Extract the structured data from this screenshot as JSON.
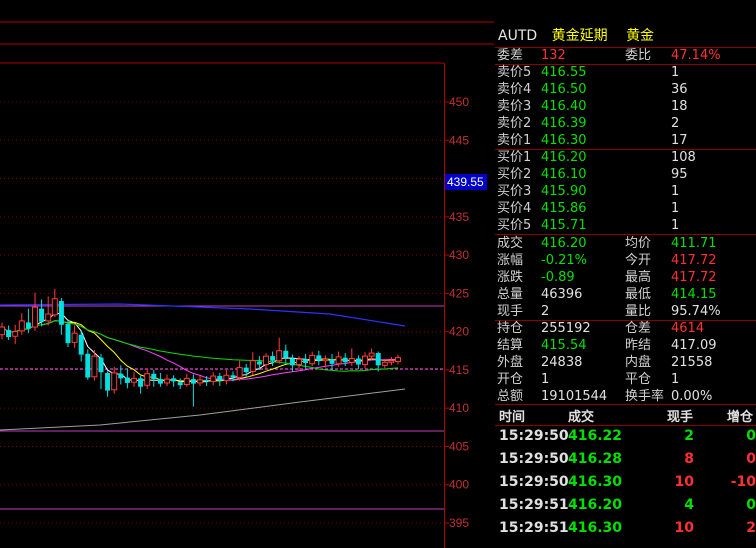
{
  "header": {
    "code": "AUTD",
    "name": "黄金延期",
    "type": "黄金"
  },
  "order_book": {
    "weicha_label": "委差",
    "weicha_value": "132",
    "weibi_label": "委比",
    "weibi_value": "47.14%",
    "asks": [
      {
        "label": "卖价5",
        "price": "416.55",
        "volume": "1"
      },
      {
        "label": "卖价4",
        "price": "416.50",
        "volume": "36"
      },
      {
        "label": "卖价3",
        "price": "416.40",
        "volume": "18"
      },
      {
        "label": "卖价2",
        "price": "416.39",
        "volume": "2"
      },
      {
        "label": "卖价1",
        "price": "416.30",
        "volume": "17"
      }
    ],
    "bids": [
      {
        "label": "买价1",
        "price": "416.20",
        "volume": "108"
      },
      {
        "label": "买价2",
        "price": "416.10",
        "volume": "95"
      },
      {
        "label": "买价3",
        "price": "415.90",
        "volume": "1"
      },
      {
        "label": "买价4",
        "price": "415.86",
        "volume": "1"
      },
      {
        "label": "买价5",
        "price": "415.71",
        "volume": "1"
      }
    ]
  },
  "stats": [
    {
      "l1": "成交",
      "v1": "416.20",
      "c1": "green",
      "l2": "均价",
      "v2": "411.71",
      "c2": "green"
    },
    {
      "l1": "涨幅",
      "v1": "-0.21%",
      "c1": "green",
      "l2": "今开",
      "v2": "417.72",
      "c2": "red"
    },
    {
      "l1": "涨跌",
      "v1": "-0.89",
      "c1": "green",
      "l2": "最高",
      "v2": "417.72",
      "c2": "red"
    },
    {
      "l1": "总量",
      "v1": "46396",
      "c1": "white",
      "l2": "最低",
      "v2": "414.15",
      "c2": "green"
    },
    {
      "l1": "现手",
      "v1": "2",
      "c1": "white",
      "l2": "量比",
      "v2": "95.74%",
      "c2": "white"
    },
    {
      "l1": "持仓",
      "v1": "255192",
      "c1": "white",
      "l2": "仓差",
      "v2": "4614",
      "c2": "red"
    },
    {
      "l1": "结算",
      "v1": "415.54",
      "c1": "green",
      "l2": "昨结",
      "v2": "417.09",
      "c2": "white"
    },
    {
      "l1": "外盘",
      "v1": "24838",
      "c1": "white",
      "l2": "内盘",
      "v2": "21558",
      "c2": "white"
    },
    {
      "l1": "开仓",
      "v1": "1",
      "c1": "white",
      "l2": "平仓",
      "v2": "1",
      "c2": "white"
    },
    {
      "l1": "总额",
      "v1": "19101544",
      "c1": "white",
      "l2": "换手率",
      "v2": "0.00%",
      "c2": "white"
    }
  ],
  "ticks": {
    "headers": [
      "时间",
      "成交",
      "现手",
      "增仓"
    ],
    "rows": [
      {
        "time": "15:29:50",
        "price": "416.22",
        "vol": "2",
        "oi": "0",
        "vol_color": "green",
        "oi_color": "green"
      },
      {
        "time": "15:29:50",
        "price": "416.28",
        "vol": "8",
        "oi": "0",
        "vol_color": "red",
        "oi_color": "red"
      },
      {
        "time": "15:29:50",
        "price": "416.30",
        "vol": "10",
        "oi": "-10",
        "vol_color": "red",
        "oi_color": "red"
      },
      {
        "time": "15:29:51",
        "price": "416.20",
        "vol": "4",
        "oi": "0",
        "vol_color": "green",
        "oi_color": "green"
      },
      {
        "time": "15:29:51",
        "price": "416.30",
        "vol": "10",
        "oi": "2",
        "vol_color": "red",
        "oi_color": "red"
      }
    ]
  },
  "chart_data": {
    "type": "candlestick",
    "y_axis_labels": [
      "450",
      "445",
      "440",
      "435",
      "430",
      "425",
      "420",
      "415",
      "410",
      "405",
      "400",
      "395"
    ],
    "current_price_label": "439.55",
    "candles": [
      {
        "o": 419.6,
        "c": 420.6,
        "h": 421.2,
        "l": 419.0
      },
      {
        "o": 420.2,
        "c": 419.3,
        "h": 420.8,
        "l": 418.9
      },
      {
        "o": 419.4,
        "c": 420.0,
        "h": 420.9,
        "l": 418.4
      },
      {
        "o": 420.1,
        "c": 421.4,
        "h": 422.4,
        "l": 419.6
      },
      {
        "o": 421.2,
        "c": 420.4,
        "h": 423.0,
        "l": 419.8
      },
      {
        "o": 420.6,
        "c": 423.2,
        "h": 425.1,
        "l": 420.1
      },
      {
        "o": 423.0,
        "c": 421.3,
        "h": 424.2,
        "l": 420.7
      },
      {
        "o": 421.4,
        "c": 422.3,
        "h": 424.6,
        "l": 420.8
      },
      {
        "o": 422.2,
        "c": 424.3,
        "h": 425.6,
        "l": 421.9
      },
      {
        "o": 424.0,
        "c": 420.9,
        "h": 424.4,
        "l": 419.6
      },
      {
        "o": 421.0,
        "c": 418.5,
        "h": 421.6,
        "l": 418.0
      },
      {
        "o": 418.6,
        "c": 419.8,
        "h": 420.8,
        "l": 417.9
      },
      {
        "o": 419.6,
        "c": 417.0,
        "h": 420.1,
        "l": 416.1
      },
      {
        "o": 417.1,
        "c": 414.0,
        "h": 417.7,
        "l": 413.7
      },
      {
        "o": 414.1,
        "c": 416.8,
        "h": 417.6,
        "l": 413.6
      },
      {
        "o": 416.6,
        "c": 414.7,
        "h": 417.1,
        "l": 412.5
      },
      {
        "o": 414.6,
        "c": 412.3,
        "h": 414.8,
        "l": 411.5
      },
      {
        "o": 412.4,
        "c": 414.6,
        "h": 415.4,
        "l": 411.9
      },
      {
        "o": 414.5,
        "c": 413.9,
        "h": 415.6,
        "l": 413.1
      },
      {
        "o": 414.0,
        "c": 413.3,
        "h": 415.2,
        "l": 412.6
      },
      {
        "o": 413.4,
        "c": 413.9,
        "h": 414.7,
        "l": 412.8
      },
      {
        "o": 413.9,
        "c": 412.8,
        "h": 414.2,
        "l": 411.9
      },
      {
        "o": 413.0,
        "c": 414.5,
        "h": 415.2,
        "l": 412.5
      },
      {
        "o": 414.5,
        "c": 413.8,
        "h": 415.0,
        "l": 412.8
      },
      {
        "o": 413.8,
        "c": 413.2,
        "h": 414.6,
        "l": 412.8
      },
      {
        "o": 413.3,
        "c": 413.8,
        "h": 414.4,
        "l": 412.9
      },
      {
        "o": 413.9,
        "c": 413.5,
        "h": 414.3,
        "l": 412.8
      },
      {
        "o": 413.4,
        "c": 413.0,
        "h": 413.9,
        "l": 412.5
      },
      {
        "o": 413.1,
        "c": 413.9,
        "h": 414.5,
        "l": 412.8
      },
      {
        "o": 413.8,
        "c": 413.2,
        "h": 414.4,
        "l": 410.2
      },
      {
        "o": 413.3,
        "c": 413.7,
        "h": 414.2,
        "l": 412.9
      },
      {
        "o": 413.7,
        "c": 413.5,
        "h": 414.2,
        "l": 412.9
      },
      {
        "o": 413.5,
        "c": 414.2,
        "h": 414.7,
        "l": 413.0
      },
      {
        "o": 414.2,
        "c": 413.6,
        "h": 414.6,
        "l": 412.9
      },
      {
        "o": 413.6,
        "c": 414.3,
        "h": 415.0,
        "l": 413.1
      },
      {
        "o": 414.3,
        "c": 414.0,
        "h": 414.8,
        "l": 413.5
      },
      {
        "o": 414.0,
        "c": 415.3,
        "h": 416.2,
        "l": 413.6
      },
      {
        "o": 415.3,
        "c": 414.7,
        "h": 415.8,
        "l": 414.1
      },
      {
        "o": 414.8,
        "c": 416.2,
        "h": 417.3,
        "l": 414.3
      },
      {
        "o": 416.1,
        "c": 415.7,
        "h": 416.8,
        "l": 415.0
      },
      {
        "o": 415.7,
        "c": 416.8,
        "h": 417.2,
        "l": 415.2
      },
      {
        "o": 416.8,
        "c": 416.2,
        "h": 417.4,
        "l": 415.5
      },
      {
        "o": 416.2,
        "c": 417.5,
        "h": 419.2,
        "l": 415.8
      },
      {
        "o": 417.5,
        "c": 416.6,
        "h": 418.3,
        "l": 415.9
      },
      {
        "o": 416.5,
        "c": 415.6,
        "h": 417.0,
        "l": 414.8
      },
      {
        "o": 415.7,
        "c": 416.4,
        "h": 416.8,
        "l": 415.0
      },
      {
        "o": 416.4,
        "c": 415.9,
        "h": 417.1,
        "l": 415.2
      },
      {
        "o": 415.8,
        "c": 416.9,
        "h": 417.4,
        "l": 415.5
      },
      {
        "o": 416.9,
        "c": 416.2,
        "h": 417.5,
        "l": 415.6
      },
      {
        "o": 416.2,
        "c": 416.4,
        "h": 416.9,
        "l": 415.3
      },
      {
        "o": 416.4,
        "c": 415.8,
        "h": 417.1,
        "l": 415.0
      },
      {
        "o": 415.8,
        "c": 416.7,
        "h": 417.4,
        "l": 415.4
      },
      {
        "o": 416.6,
        "c": 416.0,
        "h": 417.2,
        "l": 415.5
      },
      {
        "o": 416.0,
        "c": 416.5,
        "h": 417.8,
        "l": 415.5
      },
      {
        "o": 416.5,
        "c": 415.7,
        "h": 416.9,
        "l": 415.1
      },
      {
        "o": 415.7,
        "c": 416.8,
        "h": 417.3,
        "l": 415.2
      },
      {
        "o": 416.8,
        "c": 417.2,
        "h": 417.8,
        "l": 416.3
      },
      {
        "o": 417.2,
        "c": 415.6,
        "h": 417.4,
        "l": 414.8
      },
      {
        "o": 415.6,
        "c": 416.0,
        "h": 416.4,
        "l": 415.2
      },
      {
        "o": 416.0,
        "c": 416.2,
        "h": 416.7,
        "l": 415.6
      },
      {
        "o": 416.1,
        "c": 416.6,
        "h": 417.0,
        "l": 415.7
      }
    ]
  }
}
